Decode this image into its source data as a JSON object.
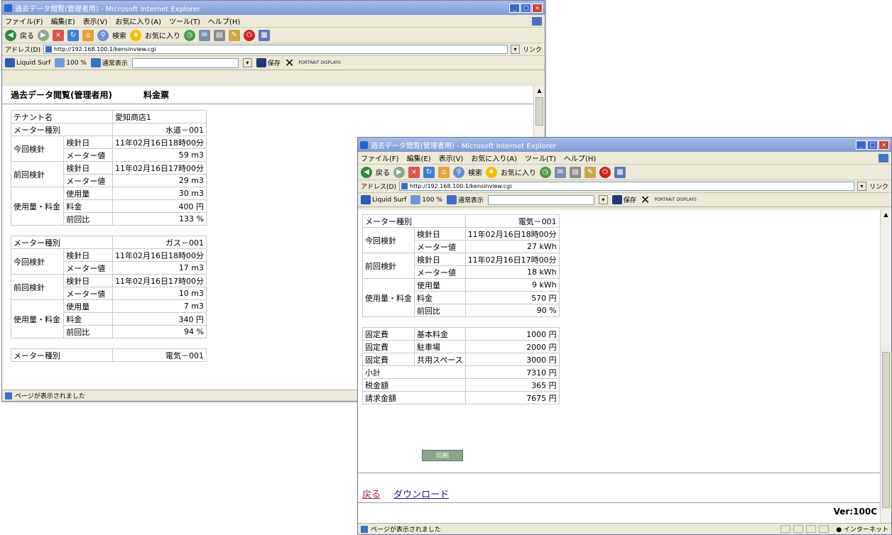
{
  "chrome": {
    "title": "過去データ閲覧(管理者用) - Microsoft Internet Explorer",
    "menu": [
      "ファイル(F)",
      "編集(E)",
      "表示(V)",
      "お気に入り(A)",
      "ツール(T)",
      "ヘルプ(H)"
    ],
    "back_label": "戻る",
    "search_label": "検索",
    "favorites_label": "お気に入り",
    "address_label": "アドレス(D)",
    "address_url": "http://192.168.100.1/kensinview.cgi",
    "links_label": "リンク",
    "liquid_surf": "Liquid Surf",
    "zoom": "100 %",
    "view_mode": "通常表示",
    "save_label": "保存",
    "brand": "PORTRAIT DISPLAYS",
    "status_text": "ページが表示されました",
    "zone_text": "インターネット"
  },
  "page": {
    "title": "過去データ閲覧(管理者用)",
    "subtitle": "料金票",
    "tenant_label": "テナント名",
    "tenant_value": "愛知商店1",
    "meter_type_label": "メーター種別",
    "current_reading_label": "今回検針",
    "previous_reading_label": "前回検針",
    "date_label": "検針日",
    "meter_value_label": "メーター値",
    "usage_charge_label": "使用量・料金",
    "usage_label": "使用量",
    "charge_label": "料金",
    "ratio_label": "前回比",
    "water": {
      "type": "水道－001",
      "cur_date": "11年02月16日18時00分",
      "cur_value": "59 m3",
      "prev_date": "11年02月16日17時00分",
      "prev_value": "29 m3",
      "usage": "30 m3",
      "charge": "400 円",
      "ratio": "133 %"
    },
    "gas": {
      "type": "ガス－001",
      "cur_date": "11年02月16日18時00分",
      "cur_value": "17 m3",
      "prev_date": "11年02月16日17時00分",
      "prev_value": "10 m3",
      "usage": "7 m3",
      "charge": "340 円",
      "ratio": "94 %"
    },
    "elec_type": "電気－001"
  },
  "page2": {
    "elec": {
      "type": "電気－001",
      "cur_date": "11年02月16日18時00分",
      "cur_value": "27 kWh",
      "prev_date": "11年02月16日17時00分",
      "prev_value": "18 kWh",
      "usage": "9 kWh",
      "charge": "570 円",
      "ratio": "90 %"
    },
    "fixed_label": "固定費",
    "fixed": [
      {
        "name": "基本料金",
        "value": "1000 円"
      },
      {
        "name": "駐車場",
        "value": "2000 円"
      },
      {
        "name": "共用スペース",
        "value": "3000 円"
      }
    ],
    "subtotal_label": "小計",
    "subtotal": "7310 円",
    "tax_label": "税金額",
    "tax": "365 円",
    "total_label": "請求金額",
    "total": "7675 円",
    "print_button": "印刷",
    "back_link": "戻る",
    "download_link": "ダウンロード",
    "version": "Ver:100C"
  }
}
